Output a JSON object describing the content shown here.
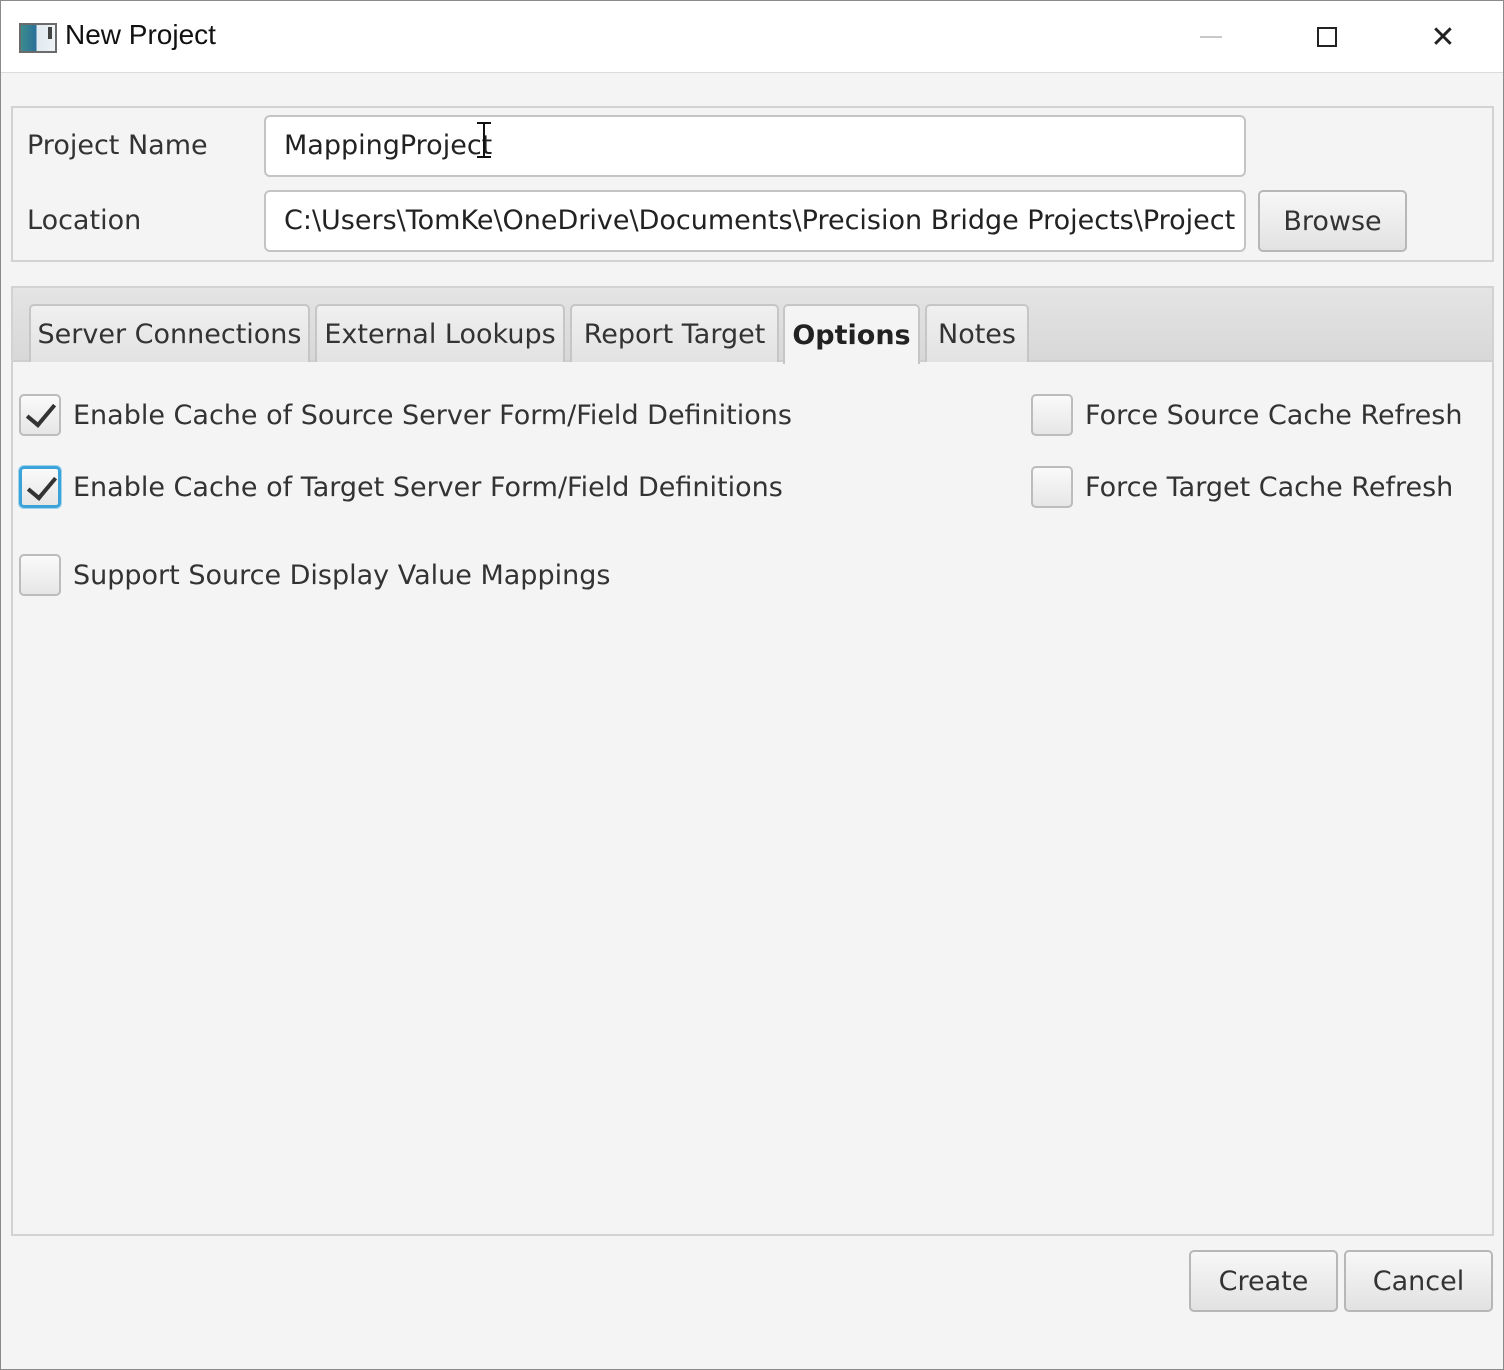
{
  "window": {
    "title": "New Project",
    "icons": {
      "app": "app-window-icon",
      "minimize": "minimize-icon",
      "maximize": "maximize-icon",
      "close": "close-icon"
    },
    "close_glyph": "✕"
  },
  "project": {
    "name_label": "Project Name",
    "name_value": "MappingProject",
    "location_label": "Location",
    "location_value": "C:\\Users\\TomKe\\OneDrive\\Documents\\Precision Bridge Projects\\Project",
    "browse_label": "Browse"
  },
  "tabs": [
    {
      "label": "Server Connections",
      "selected": false
    },
    {
      "label": "External Lookups",
      "selected": false
    },
    {
      "label": "Report Target",
      "selected": false
    },
    {
      "label": "Options",
      "selected": true
    },
    {
      "label": "Notes",
      "selected": false
    }
  ],
  "options": {
    "enable_source_cache": {
      "label": "Enable Cache of Source Server Form/Field Definitions",
      "checked": true
    },
    "enable_target_cache": {
      "label": "Enable Cache of Target Server Form/Field Definitions",
      "checked": true,
      "focused": true
    },
    "support_display_values": {
      "label": "Support Source Display Value Mappings",
      "checked": false
    },
    "force_source_refresh": {
      "label": "Force Source Cache Refresh",
      "checked": false
    },
    "force_target_refresh": {
      "label": "Force Target Cache Refresh",
      "checked": false
    }
  },
  "actions": {
    "create_label": "Create",
    "cancel_label": "Cancel"
  },
  "colors": {
    "focus_ring": "#3aa3d8",
    "background": "#f4f4f4"
  }
}
